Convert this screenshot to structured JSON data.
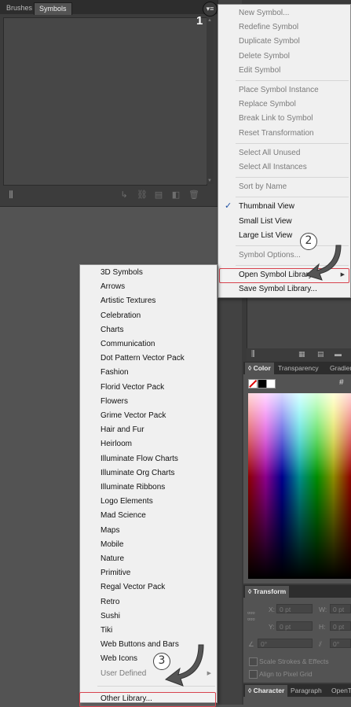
{
  "symbols_panel": {
    "tabs": [
      "Brushes",
      "Symbols"
    ],
    "footer_icons": [
      "library-icon",
      "place-icon",
      "break-link-icon",
      "options-icon",
      "new-icon",
      "delete-icon"
    ]
  },
  "flyout_button": {
    "icon": "panel-menu-icon"
  },
  "panel_menu": {
    "groups": [
      [
        {
          "label": "New Symbol...",
          "disabled": true
        },
        {
          "label": "Redefine Symbol",
          "disabled": true
        },
        {
          "label": "Duplicate Symbol",
          "disabled": true
        },
        {
          "label": "Delete Symbol",
          "disabled": true
        },
        {
          "label": "Edit Symbol",
          "disabled": true
        }
      ],
      [
        {
          "label": "Place Symbol Instance",
          "disabled": true
        },
        {
          "label": "Replace Symbol",
          "disabled": true
        },
        {
          "label": "Break Link to Symbol",
          "disabled": true
        },
        {
          "label": "Reset Transformation",
          "disabled": true
        }
      ],
      [
        {
          "label": "Select All Unused",
          "disabled": true
        },
        {
          "label": "Select All Instances",
          "disabled": true
        }
      ],
      [
        {
          "label": "Sort by Name",
          "disabled": true
        }
      ],
      [
        {
          "label": "Thumbnail View",
          "disabled": false,
          "checked": true
        },
        {
          "label": "Small List View",
          "disabled": false
        },
        {
          "label": "Large List View",
          "disabled": false
        }
      ],
      [
        {
          "label": "Symbol Options...",
          "disabled": true
        }
      ],
      [
        {
          "label": "Open Symbol Library",
          "disabled": false,
          "submenu": true,
          "highlighted": true
        },
        {
          "label": "Save Symbol Library...",
          "disabled": false
        }
      ]
    ]
  },
  "library_menu": {
    "items": [
      {
        "label": "3D Symbols"
      },
      {
        "label": "Arrows"
      },
      {
        "label": "Artistic Textures"
      },
      {
        "label": "Celebration"
      },
      {
        "label": "Charts"
      },
      {
        "label": "Communication"
      },
      {
        "label": "Dot Pattern Vector Pack"
      },
      {
        "label": "Fashion"
      },
      {
        "label": "Florid Vector Pack"
      },
      {
        "label": "Flowers"
      },
      {
        "label": "Grime Vector Pack"
      },
      {
        "label": "Hair and Fur"
      },
      {
        "label": "Heirloom"
      },
      {
        "label": "Illuminate Flow Charts"
      },
      {
        "label": "Illuminate Org Charts"
      },
      {
        "label": "Illuminate Ribbons"
      },
      {
        "label": "Logo Elements"
      },
      {
        "label": "Mad Science"
      },
      {
        "label": "Maps"
      },
      {
        "label": "Mobile"
      },
      {
        "label": "Nature"
      },
      {
        "label": "Primitive"
      },
      {
        "label": "Regal Vector Pack"
      },
      {
        "label": "Retro"
      },
      {
        "label": "Sushi"
      },
      {
        "label": "Tiki"
      },
      {
        "label": "Web Buttons and Bars"
      },
      {
        "label": "Web Icons"
      },
      {
        "label": "User Defined",
        "disabled": true,
        "submenu": true
      }
    ],
    "other": {
      "label": "Other Library..."
    }
  },
  "annotations": [
    "1",
    "2",
    "3"
  ],
  "color_panel": {
    "tabs": [
      "Color",
      "Transparency",
      "Gradient"
    ],
    "hash": "#"
  },
  "transform_panel": {
    "tab": "Transform",
    "x_label": "X:",
    "x_value": "0 pt",
    "y_label": "Y:",
    "y_value": "0 pt",
    "w_label": "W:",
    "w_value": "0 pt",
    "h_label": "H:",
    "h_value": "0 pt",
    "angle_value": "0°",
    "shear_value": "0°",
    "scale_strokes": "Scale Strokes & Effects",
    "align_pixel": "Align to Pixel Grid"
  },
  "character_panel": {
    "tabs": [
      "Character",
      "Paragraph",
      "OpenType"
    ]
  }
}
